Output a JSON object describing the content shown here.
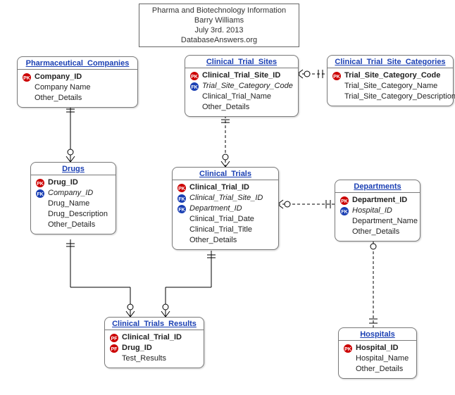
{
  "header": {
    "line1": "Pharma and Biotechnology Information",
    "line2": "Barry Williams",
    "line3": "July 3rd. 2013",
    "line4": "DatabaseAnswers.org"
  },
  "entities": {
    "pharma_companies": {
      "title": "Pharmaceutical_Companies",
      "attrs": [
        {
          "key": "PK",
          "name": "Company_ID",
          "bold": true
        },
        {
          "key": "",
          "name": "Company Name"
        },
        {
          "key": "",
          "name": "Other_Details"
        }
      ]
    },
    "clinical_trial_sites": {
      "title": "Clinical_Trial_Sites",
      "attrs": [
        {
          "key": "PK",
          "name": "Clinical_Trial_Site_ID",
          "bold": true
        },
        {
          "key": "FK",
          "name": "Trial_Site_Category_Code",
          "italic": true
        },
        {
          "key": "",
          "name": "Clinical_Trial_Name"
        },
        {
          "key": "",
          "name": "Other_Details"
        }
      ]
    },
    "site_categories": {
      "title": "Clinical_Trial_Site_Categories",
      "attrs": [
        {
          "key": "PK",
          "name": "Trial_Site_Category_Code",
          "bold": true
        },
        {
          "key": "",
          "name": "Trial_Site_Category_Name"
        },
        {
          "key": "",
          "name": "Trial_Site_Category_Description"
        }
      ]
    },
    "drugs": {
      "title": "Drugs",
      "attrs": [
        {
          "key": "PK",
          "name": "Drug_ID",
          "bold": true
        },
        {
          "key": "FK",
          "name": "Company_ID",
          "italic": true
        },
        {
          "key": "",
          "name": "Drug_Name"
        },
        {
          "key": "",
          "name": "Drug_Description"
        },
        {
          "key": "",
          "name": "Other_Details"
        }
      ]
    },
    "clinical_trials": {
      "title": "Clinical_Trials",
      "attrs": [
        {
          "key": "PK",
          "name": "Clinical_Trial_ID",
          "bold": true
        },
        {
          "key": "FK",
          "name": "Clinical_Trial_Site_ID",
          "italic": true
        },
        {
          "key": "FK",
          "name": "Department_ID",
          "italic": true
        },
        {
          "key": "",
          "name": "Clinical_Trial_Date"
        },
        {
          "key": "",
          "name": "Clinical_Trial_Title"
        },
        {
          "key": "",
          "name": "Other_Details"
        }
      ]
    },
    "departments": {
      "title": "Departments",
      "attrs": [
        {
          "key": "PK",
          "name": "Department_ID",
          "bold": true
        },
        {
          "key": "FK",
          "name": "Hospital_ID",
          "italic": true
        },
        {
          "key": "",
          "name": "Department_Name"
        },
        {
          "key": "",
          "name": "Other_Details"
        }
      ]
    },
    "trials_results": {
      "title": "Clinical_Trials_Results",
      "attrs": [
        {
          "key": "PF",
          "name": "Clinical_Trial_ID",
          "bold": true
        },
        {
          "key": "PF",
          "name": "Drug_ID",
          "bold": true
        },
        {
          "key": "",
          "name": "Test_Results"
        }
      ]
    },
    "hospitals": {
      "title": "Hospitals",
      "attrs": [
        {
          "key": "PK",
          "name": "Hospital_ID",
          "bold": true
        },
        {
          "key": "",
          "name": "Hospital_Name"
        },
        {
          "key": "",
          "name": "Other_Details"
        }
      ]
    }
  },
  "chart_data": {
    "type": "er-diagram",
    "title": "Pharma and Biotechnology Information",
    "author": "Barry Williams",
    "date": "July 3rd. 2013",
    "source": "DatabaseAnswers.org",
    "entities": [
      {
        "name": "Pharmaceutical_Companies",
        "pk": [
          "Company_ID"
        ],
        "attrs": [
          "Company Name",
          "Other_Details"
        ]
      },
      {
        "name": "Clinical_Trial_Sites",
        "pk": [
          "Clinical_Trial_Site_ID"
        ],
        "fk": [
          "Trial_Site_Category_Code"
        ],
        "attrs": [
          "Clinical_Trial_Name",
          "Other_Details"
        ]
      },
      {
        "name": "Clinical_Trial_Site_Categories",
        "pk": [
          "Trial_Site_Category_Code"
        ],
        "attrs": [
          "Trial_Site_Category_Name",
          "Trial_Site_Category_Description"
        ]
      },
      {
        "name": "Drugs",
        "pk": [
          "Drug_ID"
        ],
        "fk": [
          "Company_ID"
        ],
        "attrs": [
          "Drug_Name",
          "Drug_Description",
          "Other_Details"
        ]
      },
      {
        "name": "Clinical_Trials",
        "pk": [
          "Clinical_Trial_ID"
        ],
        "fk": [
          "Clinical_Trial_Site_ID",
          "Department_ID"
        ],
        "attrs": [
          "Clinical_Trial_Date",
          "Clinical_Trial_Title",
          "Other_Details"
        ]
      },
      {
        "name": "Departments",
        "pk": [
          "Department_ID"
        ],
        "fk": [
          "Hospital_ID"
        ],
        "attrs": [
          "Department_Name",
          "Other_Details"
        ]
      },
      {
        "name": "Clinical_Trials_Results",
        "pk": [
          "Clinical_Trial_ID",
          "Drug_ID"
        ],
        "attrs": [
          "Test_Results"
        ]
      },
      {
        "name": "Hospitals",
        "pk": [
          "Hospital_ID"
        ],
        "attrs": [
          "Hospital_Name",
          "Other_Details"
        ]
      }
    ],
    "relationships": [
      {
        "from": "Pharmaceutical_Companies",
        "to": "Drugs",
        "type": "one-to-many"
      },
      {
        "from": "Clinical_Trial_Sites",
        "to": "Clinical_Trial_Site_Categories",
        "type": "many-to-one"
      },
      {
        "from": "Clinical_Trial_Sites",
        "to": "Clinical_Trials",
        "type": "one-to-many"
      },
      {
        "from": "Clinical_Trials",
        "to": "Departments",
        "type": "many-to-one"
      },
      {
        "from": "Drugs",
        "to": "Clinical_Trials_Results",
        "type": "one-to-many"
      },
      {
        "from": "Clinical_Trials",
        "to": "Clinical_Trials_Results",
        "type": "one-to-many"
      },
      {
        "from": "Departments",
        "to": "Hospitals",
        "type": "many-to-one"
      }
    ]
  }
}
